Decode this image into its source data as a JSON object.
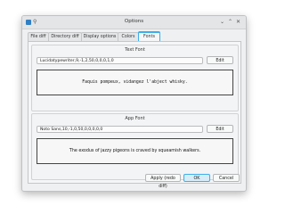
{
  "window": {
    "title": "Options",
    "titlebar_icons": [
      "app-icon",
      "pin-icon",
      "minimize-icon",
      "maximize-icon",
      "close-icon"
    ],
    "pin_glyph": "⚲",
    "min_glyph": "⌄",
    "max_glyph": "⌃",
    "close_glyph": "✕"
  },
  "tabs": [
    {
      "label": "File diff",
      "active": false
    },
    {
      "label": "Directory diff",
      "active": false
    },
    {
      "label": "Display options",
      "active": false
    },
    {
      "label": "Colors",
      "active": false
    },
    {
      "label": "Fonts",
      "active": true
    }
  ],
  "text_font": {
    "title": "Text Font",
    "value": "Lucidatypewriter,9,-1,2,50,0,0,0,1,0",
    "edit_label": "Edit",
    "preview": "Faquis pompeux, vidangez l'abject whisky."
  },
  "app_font": {
    "title": "App Font",
    "value": "Noto Sans,10,-1,0,50,0,0,0,0,0",
    "edit_label": "Edit",
    "preview": "The exodus of jazzy pigeons is craved by squeamish walkers."
  },
  "footer": {
    "apply_label": "Apply (redo diff)",
    "ok_label": "OK",
    "cancel_label": "Cancel"
  },
  "colors": {
    "accent": "#3daee9",
    "window_bg": "#eff0f1"
  }
}
